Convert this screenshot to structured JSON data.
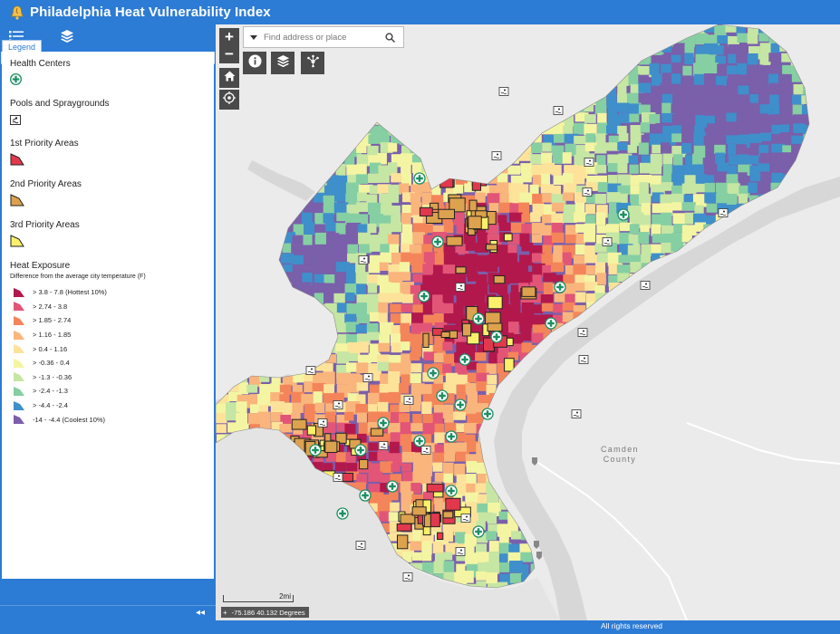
{
  "header": {
    "title": "Philadelphia Heat Vulnerability Index",
    "logo_icon": "liberty-bell-icon"
  },
  "sidebar": {
    "toolbar": {
      "legend_icon": "legend-list-icon",
      "layers_icon": "layers-icon"
    },
    "legend_tab_label": "Legend",
    "sections": {
      "health": "Health Centers",
      "pools": "Pools and Spraygrounds",
      "first": "1st Priority Areas",
      "second": "2nd Priority Areas",
      "third": "3rd Priority Areas",
      "heat": "Heat Exposure",
      "heat_sub": "Difference from the average city temperature (F)"
    },
    "heat_classes": [
      {
        "label": "> 3.8 - 7.8 (Hottest 10%)",
        "color": "#b2184c"
      },
      {
        "label": "> 2.74 - 3.8",
        "color": "#e25577"
      },
      {
        "label": "> 1.85 - 2.74",
        "color": "#f4855a"
      },
      {
        "label": "> 1.16 - 1.85",
        "color": "#f9b57c"
      },
      {
        "label": "> 0.4 - 1.16",
        "color": "#fde39a"
      },
      {
        "label": "> -0.36 - 0.4",
        "color": "#f4f5a2"
      },
      {
        "label": "> -1.3 - -0.36",
        "color": "#c6e6a3"
      },
      {
        "label": "> -2.4 - -1.3",
        "color": "#86cfa3"
      },
      {
        "label": "> -4.4 - -2.4",
        "color": "#3f8fcb"
      },
      {
        "label": "-14 - -4.4 (Coolest 10%)",
        "color": "#7a5fab"
      }
    ],
    "priority_colors": {
      "first": "#e2384d",
      "second": "#dda24e",
      "third": "#fbf06a"
    }
  },
  "map": {
    "search_placeholder": "Find address or place",
    "zoom_in": "+",
    "zoom_out": "−",
    "scale_label": "2mi",
    "coords": "-75.186 40.132 Degrees",
    "camden_line1": "Camden",
    "camden_line2": "County"
  },
  "footer": {
    "rights": "All rights reserved"
  }
}
